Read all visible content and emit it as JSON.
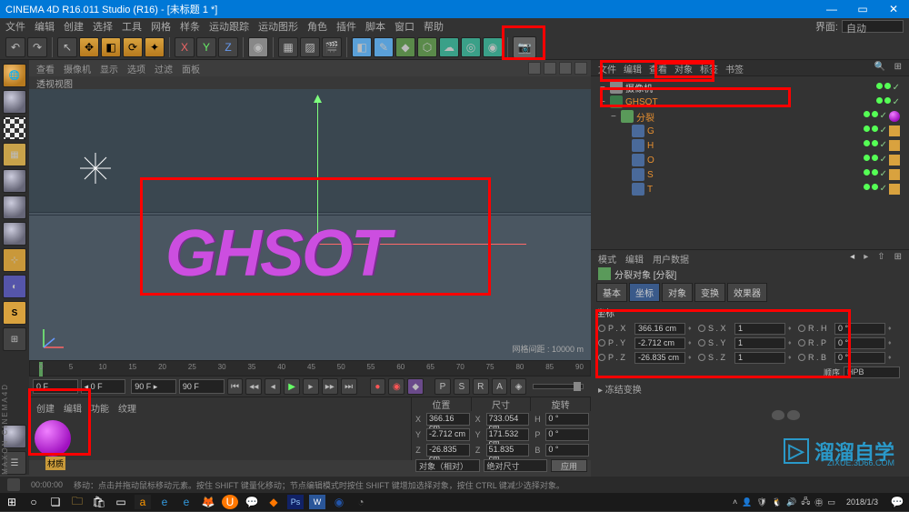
{
  "title": "CINEMA 4D R16.011 Studio (R16) - [未标题 1 *]",
  "menu": [
    "文件",
    "编辑",
    "创建",
    "选择",
    "工具",
    "网格",
    "样条",
    "运动跟踪",
    "运动图形",
    "角色",
    "插件",
    "脚本",
    "窗口",
    "帮助"
  ],
  "layout_label": "界面:",
  "layout_value": "自动",
  "viewport": {
    "tabs": [
      "查看",
      "摄像机",
      "显示",
      "选项",
      "过滤",
      "面板"
    ],
    "title": "透视视图",
    "text3d": "GHSOT",
    "info": "网格间距 : 10000 m"
  },
  "timeline": {
    "start": "0 F",
    "from": "0 F",
    "end": "90 F",
    "to": "90 F",
    "marks": [
      0,
      5,
      10,
      15,
      20,
      25,
      30,
      35,
      40,
      45,
      50,
      55,
      60,
      65,
      70,
      75,
      80,
      85,
      90
    ]
  },
  "materials": {
    "tabs": [
      "创建",
      "编辑",
      "功能",
      "纹理"
    ],
    "item": "材质"
  },
  "coord": {
    "headers": [
      "位置",
      "尺寸",
      "旋转"
    ],
    "rows": [
      {
        "a": "X",
        "p": "366.16 cm",
        "s": "733.054 cm",
        "r": "H",
        "rv": "0 °"
      },
      {
        "a": "Y",
        "p": "-2.712 cm",
        "s": "171.532 cm",
        "r": "P",
        "rv": "0 °"
      },
      {
        "a": "Z",
        "p": "-26.835 cm",
        "s": "51.835 cm",
        "r": "B",
        "rv": "0 °"
      }
    ],
    "combo1": "对象（相对）",
    "combo2": "绝对尺寸",
    "apply": "应用"
  },
  "objects": {
    "tabs": [
      "文件",
      "编辑",
      "查看",
      "对象",
      "标签",
      "书签"
    ],
    "tree": [
      {
        "lvl": 0,
        "icon": "cam",
        "label": "摄像机",
        "orange": false,
        "exp": "−"
      },
      {
        "lvl": 0,
        "icon": "track",
        "label": "GHSOT",
        "orange": true,
        "exp": "−"
      },
      {
        "lvl": 1,
        "icon": "frac",
        "label": "分裂",
        "orange": true,
        "exp": "−",
        "tag": "ball"
      },
      {
        "lvl": 2,
        "icon": "text",
        "label": "G",
        "orange": true,
        "tag": "o"
      },
      {
        "lvl": 2,
        "icon": "text",
        "label": "H",
        "orange": true,
        "tag": "o"
      },
      {
        "lvl": 2,
        "icon": "text",
        "label": "O",
        "orange": true,
        "tag": "o"
      },
      {
        "lvl": 2,
        "icon": "text",
        "label": "S",
        "orange": true,
        "tag": "o"
      },
      {
        "lvl": 2,
        "icon": "text",
        "label": "T",
        "orange": true,
        "tag": "o"
      }
    ]
  },
  "attr": {
    "head": [
      "模式",
      "编辑",
      "用户数据"
    ],
    "title": "分裂对象 [分裂]",
    "tabs": [
      "基本",
      "坐标",
      "对象",
      "变换",
      "效果器"
    ],
    "active_tab": 1,
    "section": "坐标",
    "rows": [
      {
        "l1": "P . X",
        "v1": "366.16 cm",
        "l2": "S . X",
        "v2": "1",
        "l3": "R . H",
        "v3": "0 °"
      },
      {
        "l1": "P . Y",
        "v1": "-2.712 cm",
        "l2": "S . Y",
        "v2": "1",
        "l3": "R . P",
        "v3": "0 °"
      },
      {
        "l1": "P . Z",
        "v1": "-26.835 cm",
        "l2": "S . Z",
        "v2": "1",
        "l3": "R . B",
        "v3": "0 °"
      }
    ],
    "order_label": "顺序",
    "order_value": "HPB",
    "collapse": "▸ 冻结变换"
  },
  "status": {
    "time": "00:00:00",
    "hint": "移动：点击并拖动鼠标移动元素。按住 SHIFT 键量化移动；节点编辑模式时按住 SHIFT 键增加选择对象，按住 CTRL 键减少选择对象。"
  },
  "taskbar_date": "2018/1/3",
  "watermark": {
    "brand": "溜溜自学",
    "url": "ZIXUE.3D66.COM"
  },
  "maxon": "MAXON CINEMA4D"
}
